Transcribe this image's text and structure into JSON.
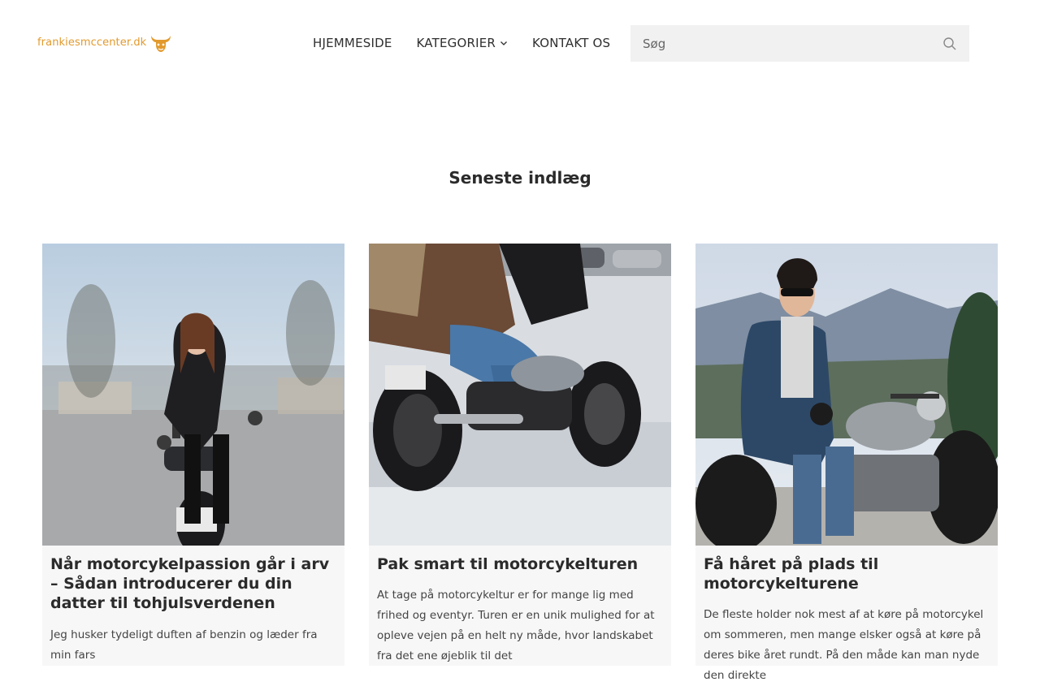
{
  "header": {
    "logo_text": "frankiesmccenter.dk",
    "nav": [
      {
        "label": "HJEMMESIDE"
      },
      {
        "label": "KATEGORIER"
      },
      {
        "label": "KONTAKT OS"
      }
    ],
    "search_placeholder": "Søg"
  },
  "main": {
    "section_title": "Seneste indlæg",
    "posts": [
      {
        "title": "Når motorcykelpassion går i arv – Sådan introducerer du din datter til tohjulsverdenen",
        "excerpt": "Jeg husker tydeligt duften af benzin og læder fra min fars"
      },
      {
        "title": "Pak smart til motorcykelturen",
        "excerpt": "At tage på motorcykeltur er for mange lig med frihed og eventyr. Turen er en unik mulighed for at opleve vejen på en helt ny måde, hvor landskabet fra det ene øjeblik til det"
      },
      {
        "title": "Få håret på plads til motorcykelturene",
        "excerpt": "De fleste holder nok mest af at køre på motorcykel om sommeren, men mange elsker også at køre på deres bike året rundt. På den måde kan man nyde den direkte"
      }
    ]
  },
  "colors": {
    "logo_accent": "#e29a2d",
    "card_bg": "#f7f7f7",
    "search_bg": "#f1f1f1"
  }
}
